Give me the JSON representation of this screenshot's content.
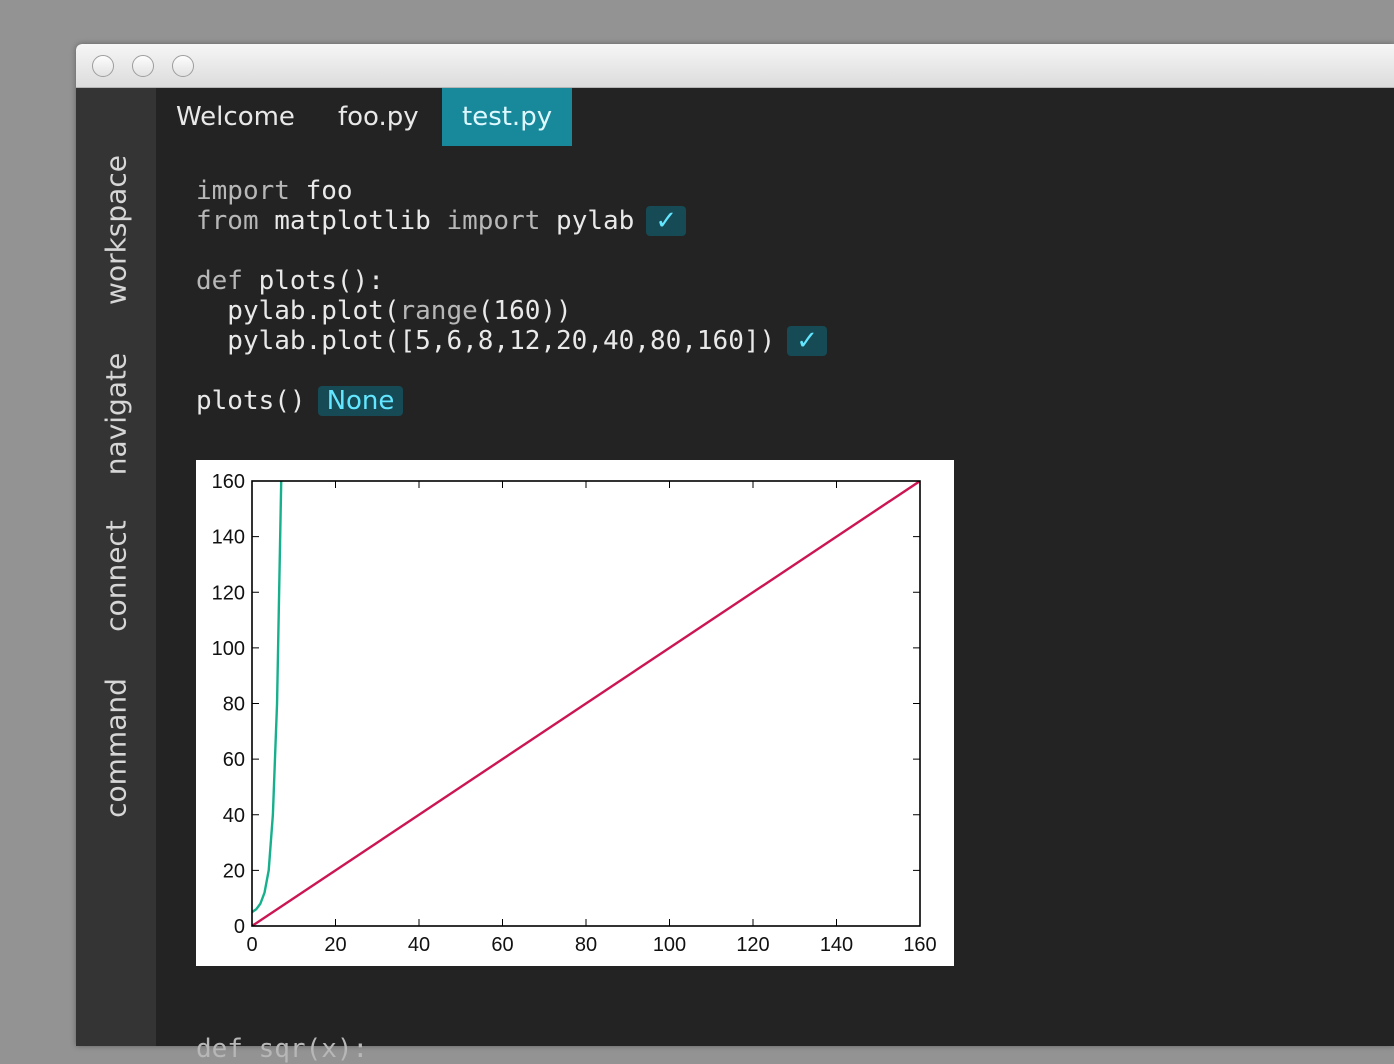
{
  "sidebar": {
    "items": [
      {
        "label": "workspace"
      },
      {
        "label": "navigate"
      },
      {
        "label": "connect"
      },
      {
        "label": "command"
      }
    ]
  },
  "tabs": [
    {
      "label": "Welcome",
      "active": false
    },
    {
      "label": "foo.py",
      "active": false
    },
    {
      "label": "test.py",
      "active": true
    }
  ],
  "code": {
    "l1_kw": "import",
    "l1_mod": " foo",
    "l2_kw1": "from",
    "l2_mod": " matplotlib ",
    "l2_kw2": "import",
    "l2_name": " pylab",
    "l2_result": "✓",
    "l4_kw": "def",
    "l4_sig": " plots():",
    "l5_pre": "  pylab.plot(",
    "l5_builtin": "range",
    "l5_post": "(160))",
    "l6_code": "  pylab.plot([5,6,8,12,20,40,80,160])",
    "l6_result": "✓",
    "l8_code": "plots()",
    "l8_result": "None",
    "cutoff": "def sqr(x):"
  },
  "colors": {
    "accent": "#17899b",
    "badge_bg": "#164a55",
    "badge_text": "#63e6ff",
    "series_1": "#cc1553",
    "series_2": "#17b08c"
  },
  "chart_data": {
    "type": "line",
    "xlim": [
      0,
      160
    ],
    "ylim": [
      0,
      160
    ],
    "xticks": [
      0,
      20,
      40,
      60,
      80,
      100,
      120,
      140,
      160
    ],
    "yticks": [
      0,
      20,
      40,
      60,
      80,
      100,
      120,
      140,
      160
    ],
    "grid": false,
    "series": [
      {
        "color": "#cc1553",
        "x": [
          0,
          160
        ],
        "y": [
          0,
          160
        ]
      },
      {
        "color": "#17b08c",
        "x": [
          0,
          1,
          2,
          3,
          4,
          5,
          6,
          7
        ],
        "y": [
          5,
          6,
          8,
          12,
          20,
          40,
          80,
          160
        ]
      }
    ]
  }
}
